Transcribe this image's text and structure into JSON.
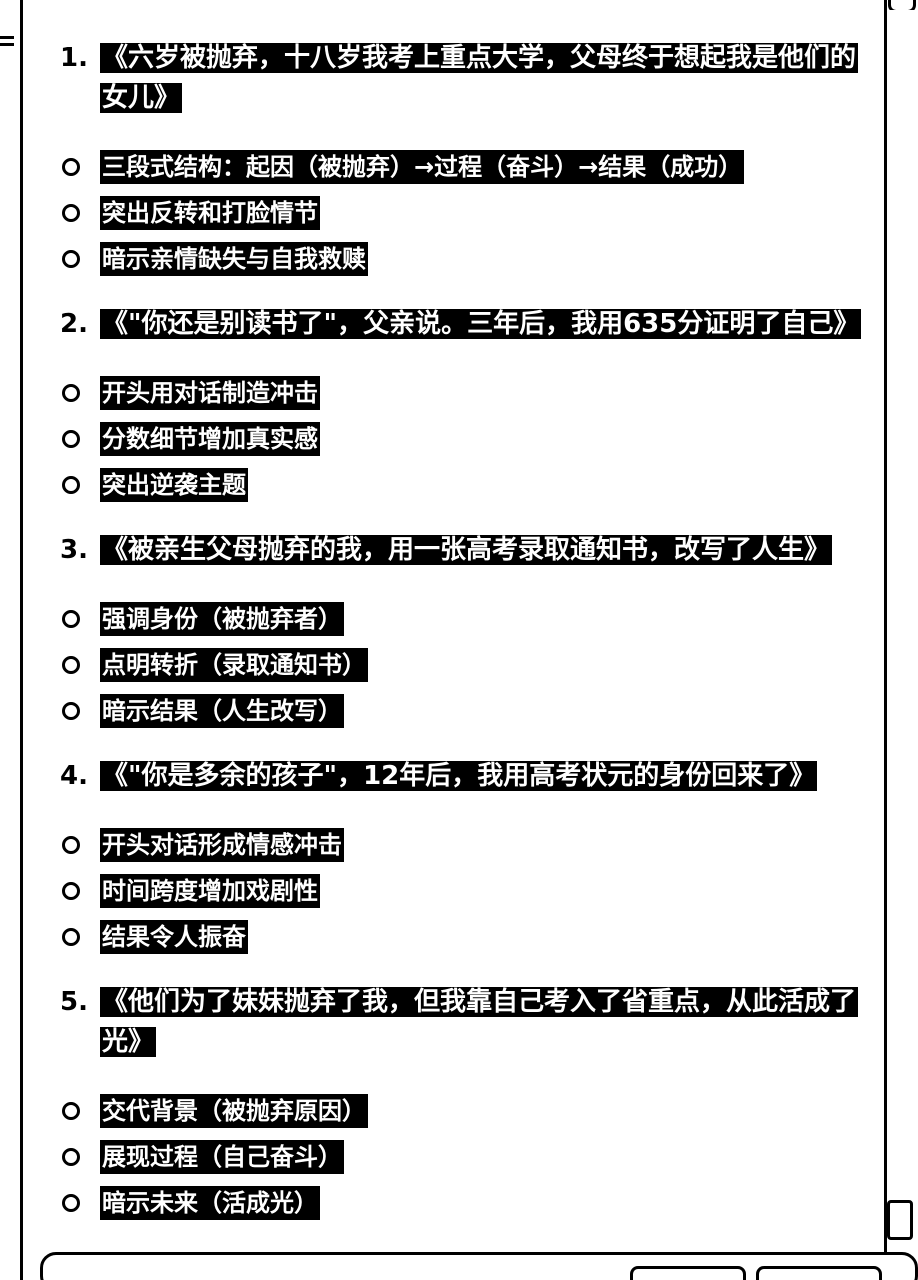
{
  "items": [
    {
      "number": "1.",
      "title": "《六岁被抛弃，十八岁我考上重点大学，父母终于想起我是他们的女儿》",
      "bullets": [
        "三段式结构：起因（被抛弃）→过程（奋斗）→结果（成功）",
        "突出反转和打脸情节",
        "暗示亲情缺失与自我救赎"
      ]
    },
    {
      "number": "2.",
      "title": "《\"你还是别读书了\"，父亲说。三年后，我用635分证明了自己》",
      "bullets": [
        "开头用对话制造冲击",
        "分数细节增加真实感",
        "突出逆袭主题"
      ]
    },
    {
      "number": "3.",
      "title": "《被亲生父母抛弃的我，用一张高考录取通知书，改写了人生》",
      "bullets": [
        "强调身份（被抛弃者）",
        "点明转折（录取通知书）",
        "暗示结果（人生改写）"
      ]
    },
    {
      "number": "4.",
      "title": "《\"你是多余的孩子\"，12年后，我用高考状元的身份回来了》",
      "bullets": [
        "开头对话形成情感冲击",
        "时间跨度增加戏剧性",
        "结果令人振奋"
      ]
    },
    {
      "number": "5.",
      "title": "《他们为了妹妹抛弃了我，但我靠自己考入了省重点，从此活成了光》",
      "bullets": [
        "交代背景（被抛弃原因）",
        "展现过程（自己奋斗）",
        "暗示未来（活成光）"
      ]
    }
  ],
  "icons": {
    "menu": "hamburger-icon",
    "bullet": "hollow-circle-icon"
  },
  "colors": {
    "text_highlight_bg": "#000000",
    "text_highlight_fg": "#ffffff",
    "background": "#ffffff"
  }
}
